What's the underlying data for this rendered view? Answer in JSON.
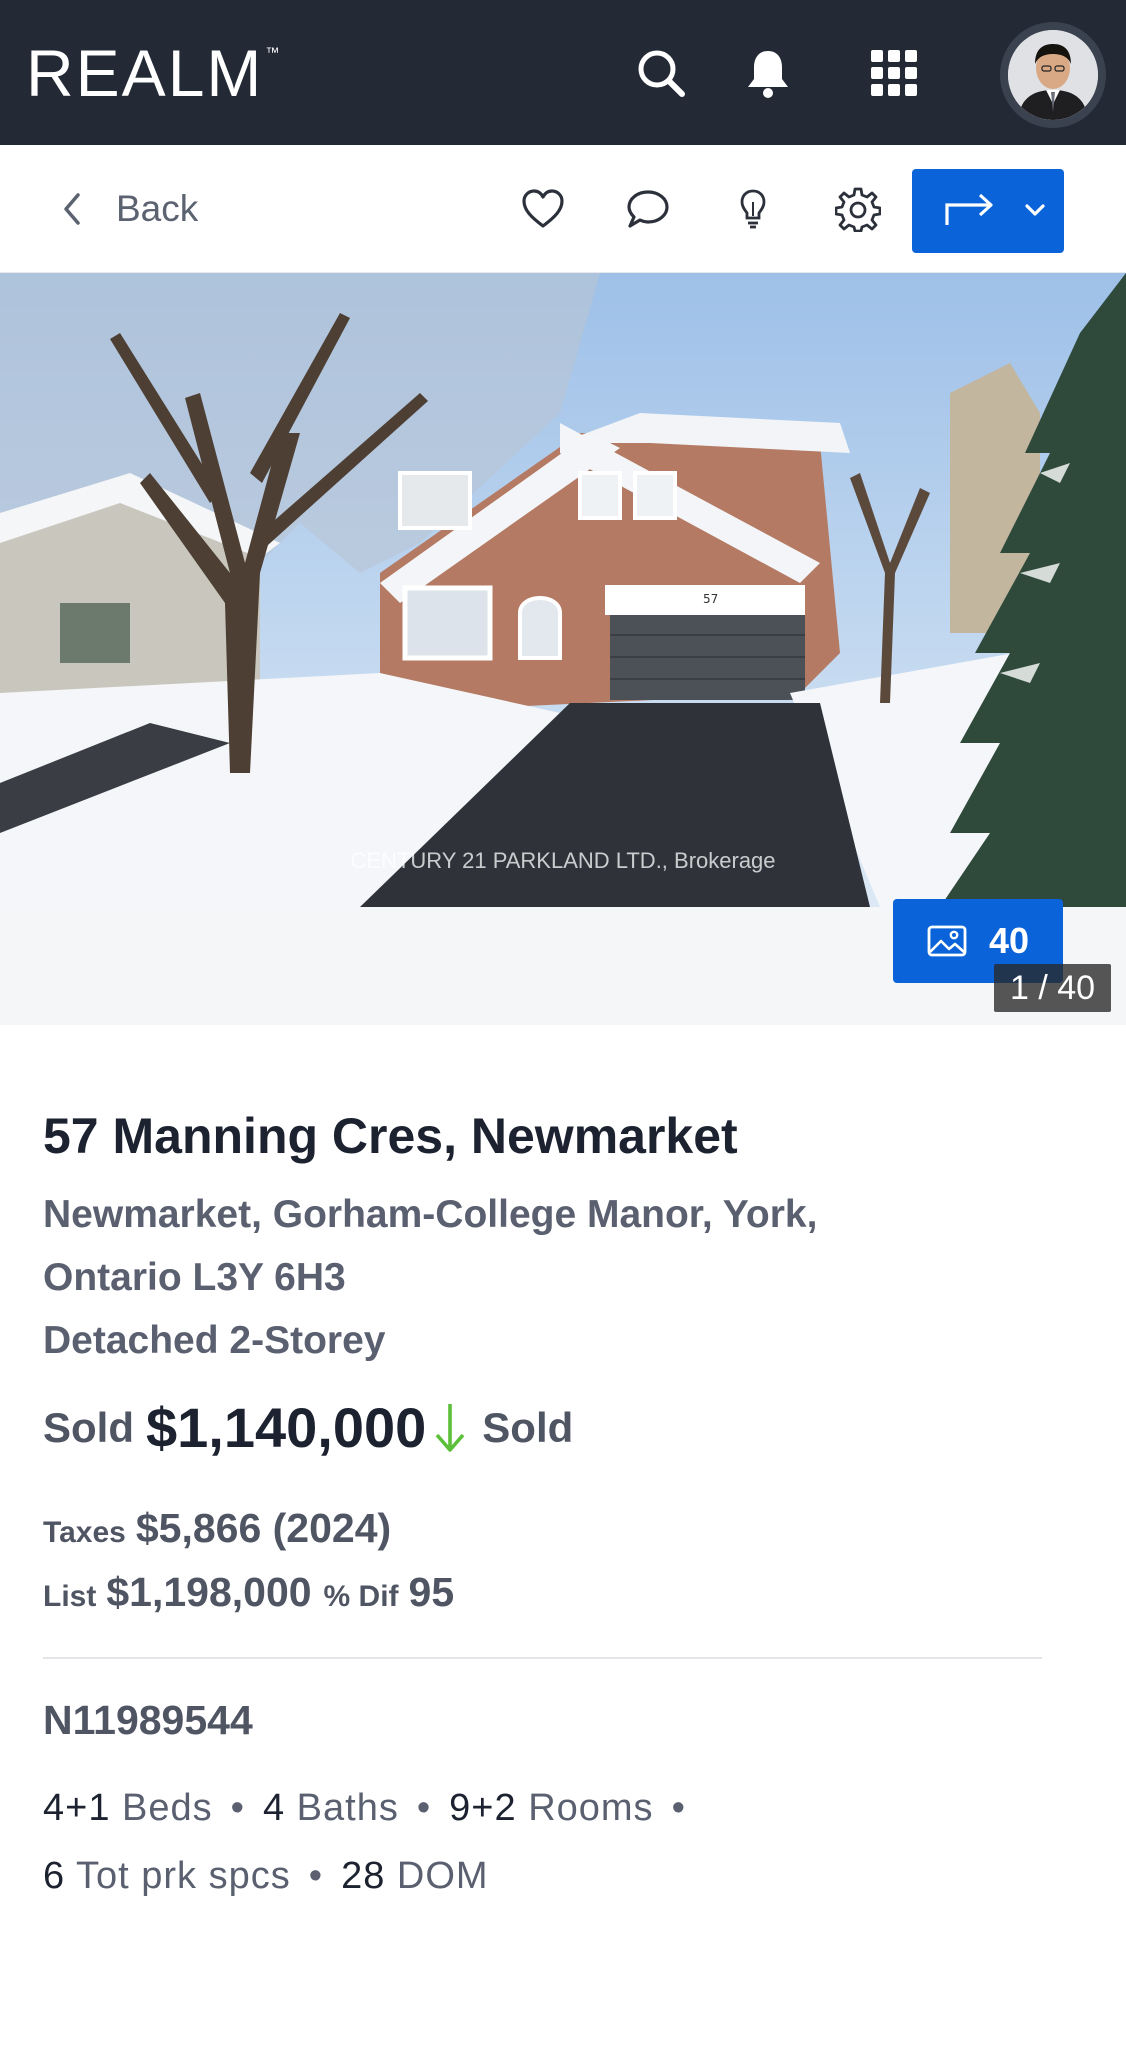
{
  "app": {
    "logo": "REALM",
    "logo_tm": "™"
  },
  "header": {
    "back_label": "Back"
  },
  "gallery": {
    "photo_credit": "CENTURY 21 PARKLAND LTD., Brokerage",
    "photos_count": "40",
    "pager": "1 / 40"
  },
  "listing": {
    "address": "57 Manning Cres, Newmarket",
    "location_line1": "Newmarket, Gorham-College Manor, York,",
    "location_line2": "Ontario L3Y 6H3",
    "type": "Detached 2-Storey",
    "status_prefix": "Sold",
    "price": "$1,140,000",
    "status_suffix": "Sold",
    "taxes_label": "Taxes",
    "taxes_value": "$5,866 (2024)",
    "list_label": "List",
    "list_value": "$1,198,000",
    "dif_label": "% Dif",
    "dif_value": "95",
    "mls": "N11989544",
    "beds_value": "4+1",
    "beds_label": "Beds",
    "baths_value": "4",
    "baths_label": "Baths",
    "rooms_value": "9+2",
    "rooms_label": "Rooms",
    "parking_value": "6",
    "parking_label": "Tot prk spcs",
    "dom_value": "28",
    "dom_label": "DOM"
  },
  "colors": {
    "topbar": "#232a36",
    "accent": "#0a63d9",
    "down_arrow": "#5bbf3a"
  }
}
